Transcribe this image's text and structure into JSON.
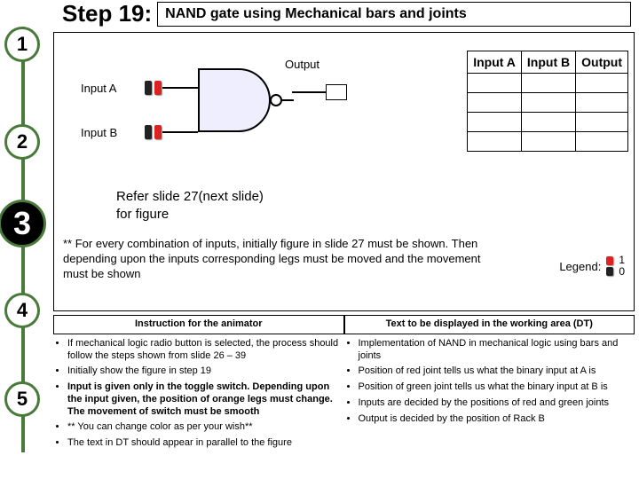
{
  "rail": {
    "s1": "1",
    "s2": "2",
    "s3": "3",
    "s4": "4",
    "s5": "5"
  },
  "header": {
    "step_label": "Step 19:",
    "title": "NAND gate using Mechanical bars and joints"
  },
  "diagram": {
    "output_label": "Output",
    "inputA_label": "Input A",
    "inputB_label": "Input B"
  },
  "truth": {
    "hA": "Input A",
    "hB": "Input B",
    "hO": "Output"
  },
  "refer_line1": "Refer slide 27(next slide)",
  "refer_line2": "for figure",
  "combo_note": "** For every combination of inputs, initially figure in slide 27 must be shown. Then depending upon the inputs corresponding legs must be moved and the movement must be shown",
  "legend_label": "Legend:",
  "legend_v1": "1",
  "legend_v0": "0",
  "lower": {
    "left_head": "Instruction for the animator",
    "right_head": "Text to be displayed in the working area (DT)",
    "left": [
      "If mechanical logic radio button is selected, the process should follow the steps shown from slide 26 – 39",
      "Initially show the figure in step 19",
      "Input is given only in the toggle switch. Depending upon the input given, the position of orange legs must change. The movement of switch must be smooth",
      "** You can change color as per your wish**",
      "The text in DT should appear  in parallel to the figure"
    ],
    "right": [
      "Implementation of NAND in mechanical logic using bars and joints",
      "Position of red joint tells us what the binary input at A is",
      "Position of green joint tells us what the binary input at B is",
      "Inputs are decided by the positions of red and green joints",
      "Output is decided by the position of Rack B"
    ]
  }
}
